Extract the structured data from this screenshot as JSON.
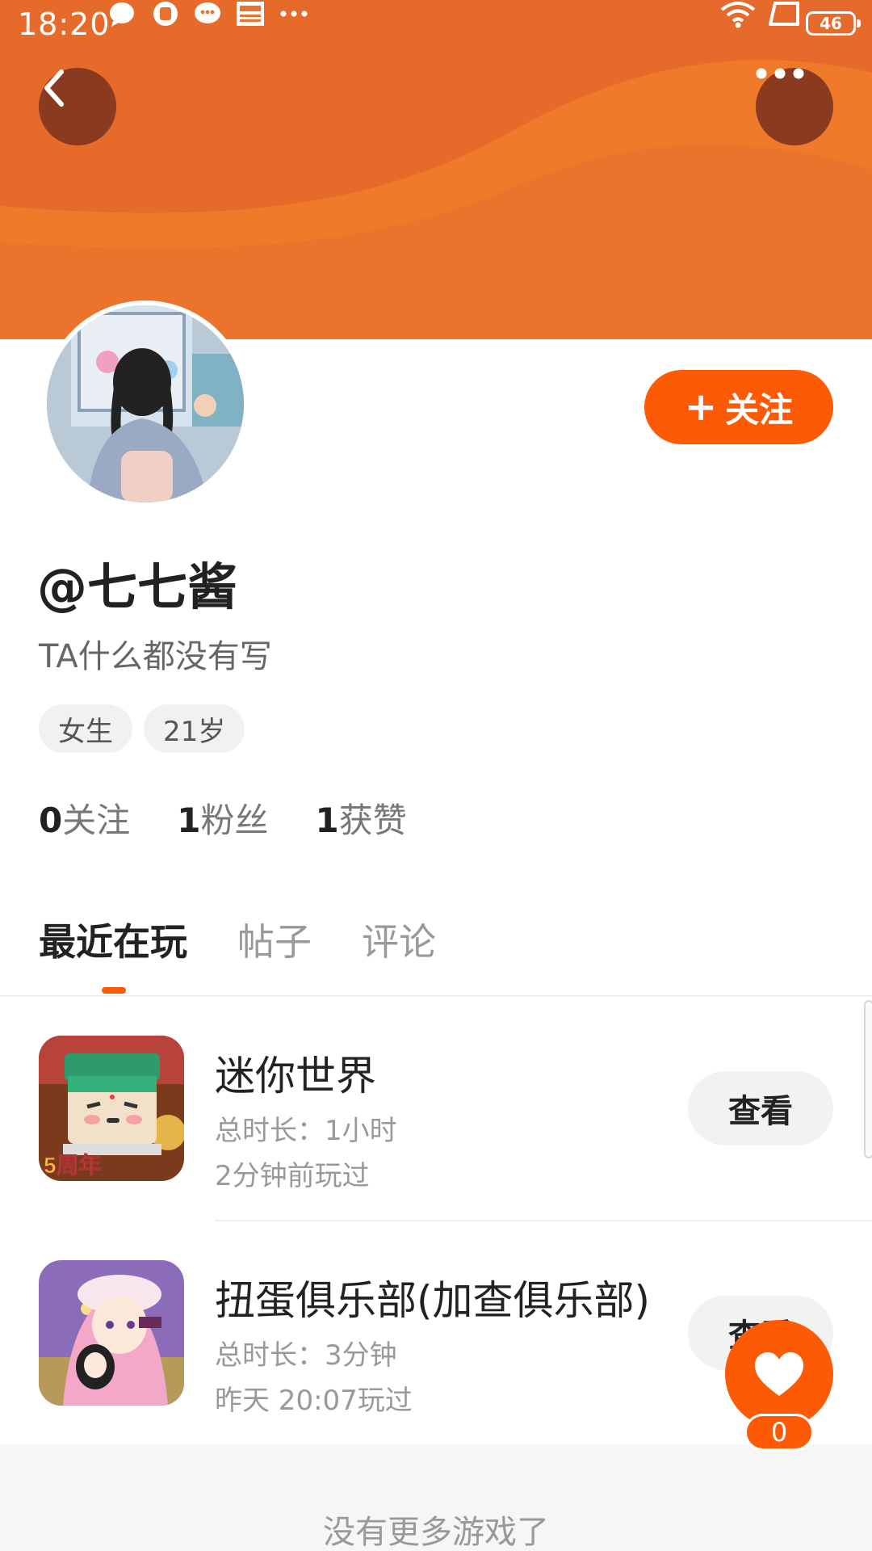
{
  "status_bar": {
    "time": "18:20",
    "battery": "46",
    "notification_icons": [
      "chat-bubble-icon",
      "app-notification-icon",
      "wechat-icon",
      "news-icon",
      "more-dots-icon"
    ],
    "right_icons": [
      "wifi-icon",
      "screen-rotate-icon",
      "battery-icon"
    ]
  },
  "header": {
    "back_icon": "chevron-left-icon",
    "more_icon": "more-horizontal-icon",
    "accent_color": "#ec6f2a"
  },
  "profile": {
    "username": "@七七酱",
    "bio": "TA什么都没有写",
    "tags": [
      "女生",
      "21岁"
    ],
    "follow_plus": "+",
    "follow_label": "关注",
    "stats": [
      {
        "num": "0",
        "label": "关注"
      },
      {
        "num": "1",
        "label": "粉丝"
      },
      {
        "num": "1",
        "label": "获赞"
      }
    ]
  },
  "tabs": [
    "最近在玩",
    "帖子",
    "评论"
  ],
  "games": [
    {
      "title": "迷你世界",
      "duration": "总时长：1小时",
      "last_played": "2分钟前玩过",
      "button": "查看",
      "icon_badge": "5周年"
    },
    {
      "title": "扭蛋俱乐部(加查俱乐部)",
      "duration": "总时长：3分钟",
      "last_played": "昨天 20:07玩过",
      "button": "查看"
    }
  ],
  "footer": {
    "text": "没有更多游戏了"
  },
  "like": {
    "count": "0",
    "icon": "heart-icon",
    "color": "#fd5a06"
  }
}
